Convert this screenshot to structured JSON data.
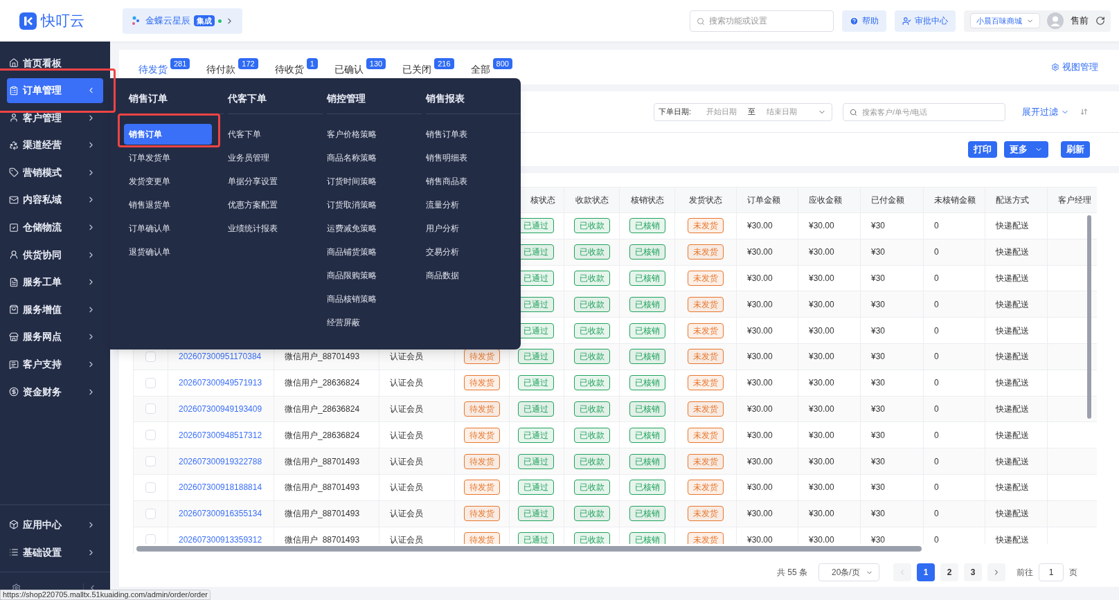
{
  "topbar": {
    "brand": "快叮云",
    "integration": {
      "name": "金蝶云星辰",
      "badge": "集成"
    },
    "search": {
      "placeholder": "搜索功能或设置"
    },
    "buttons": [
      {
        "label": "帮助",
        "kind": "help"
      },
      {
        "label": "审批中心",
        "kind": "approval"
      }
    ],
    "store": "小晨百味商城",
    "user": "售前"
  },
  "sidebar": {
    "items": [
      {
        "label": "首页看板",
        "kind": "page",
        "selected": false,
        "highlighted": false
      },
      {
        "label": "订单管理",
        "kind": "group",
        "selected": true,
        "expanded": true,
        "highlighted": true
      },
      {
        "label": "客户管理",
        "kind": "group",
        "selected": false,
        "expanded": false,
        "highlighted": false
      },
      {
        "label": "渠道经营",
        "kind": "group",
        "selected": false,
        "expanded": false,
        "highlighted": false
      },
      {
        "label": "营销模式",
        "kind": "group",
        "selected": false,
        "expanded": false,
        "highlighted": false
      },
      {
        "label": "内容私域",
        "kind": "group",
        "selected": false,
        "expanded": false,
        "highlighted": false
      },
      {
        "label": "仓储物流",
        "kind": "group",
        "selected": false,
        "expanded": false,
        "highlighted": false
      },
      {
        "label": "供货协同",
        "kind": "group",
        "selected": false,
        "expanded": false,
        "highlighted": false
      },
      {
        "label": "服务工单",
        "kind": "group",
        "selected": false,
        "expanded": false,
        "highlighted": false
      },
      {
        "label": "服务增值",
        "kind": "group",
        "selected": false,
        "expanded": false,
        "highlighted": false
      },
      {
        "label": "服务网点",
        "kind": "group",
        "selected": false,
        "expanded": false,
        "highlighted": false
      },
      {
        "label": "客户支持",
        "kind": "group",
        "selected": false,
        "expanded": false,
        "highlighted": false
      },
      {
        "label": "资金财务",
        "kind": "group",
        "selected": false,
        "expanded": false,
        "highlighted": false
      }
    ],
    "bottom_items": [
      {
        "label": "应用中心",
        "kind": "group",
        "selected": false,
        "expanded": false,
        "highlighted": false
      },
      {
        "label": "基础设置",
        "kind": "group",
        "selected": false,
        "expanded": false,
        "highlighted": false
      }
    ]
  },
  "tabs": [
    {
      "label": "待发货",
      "count": "281",
      "selected": true
    },
    {
      "label": "待付款",
      "count": "172",
      "selected": false
    },
    {
      "label": "待收货",
      "count": "1",
      "selected": false
    },
    {
      "label": "已确认",
      "count": "130",
      "selected": false
    },
    {
      "label": "已关闭",
      "count": "216",
      "selected": false
    },
    {
      "label": "全部",
      "count": "800",
      "selected": false
    }
  ],
  "view_manage": "视图管理",
  "filters": {
    "date_label": "下单日期:",
    "start_placeholder": "开始日期",
    "separator": "至",
    "end_placeholder": "结束日期",
    "search_placeholder": "搜索客户/单号/电话",
    "expand": "展开过滤"
  },
  "actions": [
    {
      "label": "打印",
      "kind": "button"
    },
    {
      "label": "更多",
      "kind": "dropdown"
    },
    {
      "label": "刷新",
      "kind": "button"
    }
  ],
  "table": {
    "columns": [
      "核状态",
      "收款状态",
      "核销状态",
      "发货状态",
      "订单金额",
      "应收金额",
      "已付金额",
      "未核销金额",
      "配送方式",
      "客户经理"
    ],
    "rows": [
      {
        "cells": [
          {
            "text": "已通过",
            "kind": "tag",
            "color": "#21a35d"
          },
          {
            "text": "已收款",
            "kind": "tag",
            "color": "#21a35d"
          },
          {
            "text": "已核销",
            "kind": "tag",
            "color": "#21a35d"
          },
          {
            "text": "未发货",
            "kind": "tag",
            "color": "#e8772e"
          },
          {
            "text": "¥30.00",
            "kind": "text"
          },
          {
            "text": "¥30.00",
            "kind": "text"
          },
          {
            "text": "¥30",
            "kind": "text"
          },
          {
            "text": "0",
            "kind": "text"
          },
          {
            "text": "快递配送",
            "kind": "text"
          }
        ]
      },
      {
        "cells": [
          {
            "text": "已通过",
            "kind": "tag",
            "color": "#21a35d"
          },
          {
            "text": "已收款",
            "kind": "tag",
            "color": "#21a35d"
          },
          {
            "text": "已核销",
            "kind": "tag",
            "color": "#21a35d"
          },
          {
            "text": "未发货",
            "kind": "tag",
            "color": "#e8772e"
          },
          {
            "text": "¥30.00",
            "kind": "text"
          },
          {
            "text": "¥30.00",
            "kind": "text"
          },
          {
            "text": "¥30",
            "kind": "text"
          },
          {
            "text": "0",
            "kind": "text"
          },
          {
            "text": "快递配送",
            "kind": "text"
          }
        ]
      },
      {
        "cells": [
          {
            "text": "已通过",
            "kind": "tag",
            "color": "#21a35d"
          },
          {
            "text": "已收款",
            "kind": "tag",
            "color": "#21a35d"
          },
          {
            "text": "已核销",
            "kind": "tag",
            "color": "#21a35d"
          },
          {
            "text": "未发货",
            "kind": "tag",
            "color": "#e8772e"
          },
          {
            "text": "¥30.00",
            "kind": "text"
          },
          {
            "text": "¥30.00",
            "kind": "text"
          },
          {
            "text": "¥30",
            "kind": "text"
          },
          {
            "text": "0",
            "kind": "text"
          },
          {
            "text": "快递配送",
            "kind": "text"
          }
        ]
      },
      {
        "cells": [
          {
            "text": "已通过",
            "kind": "tag",
            "color": "#21a35d"
          },
          {
            "text": "已收款",
            "kind": "tag",
            "color": "#21a35d"
          },
          {
            "text": "已核销",
            "kind": "tag",
            "color": "#21a35d"
          },
          {
            "text": "未发货",
            "kind": "tag",
            "color": "#e8772e"
          },
          {
            "text": "¥30.00",
            "kind": "text"
          },
          {
            "text": "¥30.00",
            "kind": "text"
          },
          {
            "text": "¥30",
            "kind": "text"
          },
          {
            "text": "0",
            "kind": "text"
          },
          {
            "text": "快递配送",
            "kind": "text"
          }
        ]
      },
      {
        "cells": [
          {
            "text": "已通过",
            "kind": "tag",
            "color": "#21a35d"
          },
          {
            "text": "已收款",
            "kind": "tag",
            "color": "#21a35d"
          },
          {
            "text": "已核销",
            "kind": "tag",
            "color": "#21a35d"
          },
          {
            "text": "未发货",
            "kind": "tag",
            "color": "#e8772e"
          },
          {
            "text": "¥30.00",
            "kind": "text"
          },
          {
            "text": "¥30.00",
            "kind": "text"
          },
          {
            "text": "¥30",
            "kind": "text"
          },
          {
            "text": "0",
            "kind": "text"
          },
          {
            "text": "快递配送",
            "kind": "text"
          }
        ]
      },
      {
        "checked": false,
        "cells": [
          {
            "text": "202607300951170384",
            "kind": "link"
          },
          {
            "text": "微信用户_88701493",
            "kind": "text"
          },
          {
            "text": "认证会员",
            "kind": "text"
          },
          {
            "text": "待发货",
            "kind": "tag",
            "color": "#e8772e"
          },
          {
            "text": "已通过",
            "kind": "tag",
            "color": "#21a35d"
          },
          {
            "text": "已收款",
            "kind": "tag",
            "color": "#21a35d"
          },
          {
            "text": "已核销",
            "kind": "tag",
            "color": "#21a35d"
          },
          {
            "text": "未发货",
            "kind": "tag",
            "color": "#e8772e"
          },
          {
            "text": "¥30.00",
            "kind": "text"
          },
          {
            "text": "¥30.00",
            "kind": "text"
          },
          {
            "text": "¥30",
            "kind": "text"
          },
          {
            "text": "0",
            "kind": "text"
          },
          {
            "text": "快递配送",
            "kind": "text"
          }
        ]
      },
      {
        "checked": false,
        "cells": [
          {
            "text": "202607300949571913",
            "kind": "link"
          },
          {
            "text": "微信用户_28636824",
            "kind": "text"
          },
          {
            "text": "认证会员",
            "kind": "text"
          },
          {
            "text": "待发货",
            "kind": "tag",
            "color": "#e8772e"
          },
          {
            "text": "已通过",
            "kind": "tag",
            "color": "#21a35d"
          },
          {
            "text": "已收款",
            "kind": "tag",
            "color": "#21a35d"
          },
          {
            "text": "已核销",
            "kind": "tag",
            "color": "#21a35d"
          },
          {
            "text": "未发货",
            "kind": "tag",
            "color": "#e8772e"
          },
          {
            "text": "¥30.00",
            "kind": "text"
          },
          {
            "text": "¥30.00",
            "kind": "text"
          },
          {
            "text": "¥30",
            "kind": "text"
          },
          {
            "text": "0",
            "kind": "text"
          },
          {
            "text": "快递配送",
            "kind": "text"
          }
        ]
      },
      {
        "checked": false,
        "cells": [
          {
            "text": "202607300949193409",
            "kind": "link"
          },
          {
            "text": "微信用户_28636824",
            "kind": "text"
          },
          {
            "text": "认证会员",
            "kind": "text"
          },
          {
            "text": "待发货",
            "kind": "tag",
            "color": "#e8772e"
          },
          {
            "text": "已通过",
            "kind": "tag",
            "color": "#21a35d"
          },
          {
            "text": "已收款",
            "kind": "tag",
            "color": "#21a35d"
          },
          {
            "text": "已核销",
            "kind": "tag",
            "color": "#21a35d"
          },
          {
            "text": "未发货",
            "kind": "tag",
            "color": "#e8772e"
          },
          {
            "text": "¥30.00",
            "kind": "text"
          },
          {
            "text": "¥30.00",
            "kind": "text"
          },
          {
            "text": "¥30",
            "kind": "text"
          },
          {
            "text": "0",
            "kind": "text"
          },
          {
            "text": "快递配送",
            "kind": "text"
          }
        ]
      },
      {
        "checked": false,
        "cells": [
          {
            "text": "202607300948517312",
            "kind": "link"
          },
          {
            "text": "微信用户_28636824",
            "kind": "text"
          },
          {
            "text": "认证会员",
            "kind": "text"
          },
          {
            "text": "待发货",
            "kind": "tag",
            "color": "#e8772e"
          },
          {
            "text": "已通过",
            "kind": "tag",
            "color": "#21a35d"
          },
          {
            "text": "已收款",
            "kind": "tag",
            "color": "#21a35d"
          },
          {
            "text": "已核销",
            "kind": "tag",
            "color": "#21a35d"
          },
          {
            "text": "未发货",
            "kind": "tag",
            "color": "#e8772e"
          },
          {
            "text": "¥30.00",
            "kind": "text"
          },
          {
            "text": "¥30.00",
            "kind": "text"
          },
          {
            "text": "¥30",
            "kind": "text"
          },
          {
            "text": "0",
            "kind": "text"
          },
          {
            "text": "快递配送",
            "kind": "text"
          }
        ]
      },
      {
        "checked": false,
        "cells": [
          {
            "text": "202607300919322788",
            "kind": "link"
          },
          {
            "text": "微信用户_88701493",
            "kind": "text"
          },
          {
            "text": "认证会员",
            "kind": "text"
          },
          {
            "text": "待发货",
            "kind": "tag",
            "color": "#e8772e"
          },
          {
            "text": "已通过",
            "kind": "tag",
            "color": "#21a35d"
          },
          {
            "text": "已收款",
            "kind": "tag",
            "color": "#21a35d"
          },
          {
            "text": "已核销",
            "kind": "tag",
            "color": "#21a35d"
          },
          {
            "text": "未发货",
            "kind": "tag",
            "color": "#e8772e"
          },
          {
            "text": "¥30.00",
            "kind": "text"
          },
          {
            "text": "¥30.00",
            "kind": "text"
          },
          {
            "text": "¥30",
            "kind": "text"
          },
          {
            "text": "0",
            "kind": "text"
          },
          {
            "text": "快递配送",
            "kind": "text"
          }
        ]
      },
      {
        "checked": false,
        "cells": [
          {
            "text": "202607300918188814",
            "kind": "link"
          },
          {
            "text": "微信用户_88701493",
            "kind": "text"
          },
          {
            "text": "认证会员",
            "kind": "text"
          },
          {
            "text": "待发货",
            "kind": "tag",
            "color": "#e8772e"
          },
          {
            "text": "已通过",
            "kind": "tag",
            "color": "#21a35d"
          },
          {
            "text": "已收款",
            "kind": "tag",
            "color": "#21a35d"
          },
          {
            "text": "已核销",
            "kind": "tag",
            "color": "#21a35d"
          },
          {
            "text": "未发货",
            "kind": "tag",
            "color": "#e8772e"
          },
          {
            "text": "¥30.00",
            "kind": "text"
          },
          {
            "text": "¥30.00",
            "kind": "text"
          },
          {
            "text": "¥30",
            "kind": "text"
          },
          {
            "text": "0",
            "kind": "text"
          },
          {
            "text": "快递配送",
            "kind": "text"
          }
        ]
      },
      {
        "checked": false,
        "cells": [
          {
            "text": "202607300916355134",
            "kind": "link"
          },
          {
            "text": "微信用户_88701493",
            "kind": "text"
          },
          {
            "text": "认证会员",
            "kind": "text"
          },
          {
            "text": "待发货",
            "kind": "tag",
            "color": "#e8772e"
          },
          {
            "text": "已通过",
            "kind": "tag",
            "color": "#21a35d"
          },
          {
            "text": "已收款",
            "kind": "tag",
            "color": "#21a35d"
          },
          {
            "text": "已核销",
            "kind": "tag",
            "color": "#21a35d"
          },
          {
            "text": "未发货",
            "kind": "tag",
            "color": "#e8772e"
          },
          {
            "text": "¥30.00",
            "kind": "text"
          },
          {
            "text": "¥30.00",
            "kind": "text"
          },
          {
            "text": "¥30",
            "kind": "text"
          },
          {
            "text": "0",
            "kind": "text"
          },
          {
            "text": "快递配送",
            "kind": "text"
          }
        ]
      },
      {
        "checked": false,
        "cells": [
          {
            "text": "202607300913359312",
            "kind": "link"
          },
          {
            "text": "微信用户_88701493",
            "kind": "text"
          },
          {
            "text": "认证会员",
            "kind": "text"
          },
          {
            "text": "待发货",
            "kind": "tag",
            "color": "#e8772e"
          },
          {
            "text": "已通过",
            "kind": "tag",
            "color": "#21a35d"
          },
          {
            "text": "已收款",
            "kind": "tag",
            "color": "#21a35d"
          },
          {
            "text": "已核销",
            "kind": "tag",
            "color": "#21a35d"
          },
          {
            "text": "未发货",
            "kind": "tag",
            "color": "#e8772e"
          },
          {
            "text": "¥30.00",
            "kind": "text"
          },
          {
            "text": "¥30.00",
            "kind": "text"
          },
          {
            "text": "¥30",
            "kind": "text"
          },
          {
            "text": "0",
            "kind": "text"
          },
          {
            "text": "快递配送",
            "kind": "text"
          }
        ]
      }
    ]
  },
  "pagination": {
    "total": "共 55 条",
    "page_size": "20条/页",
    "prev": {
      "disabled": true
    },
    "pages": [
      {
        "label": "1",
        "selected": true
      },
      {
        "label": "2",
        "selected": false
      },
      {
        "label": "3",
        "selected": false
      }
    ],
    "next": {
      "disabled": false
    },
    "goto_label": "前往",
    "goto_value": "1",
    "page_unit": "页"
  },
  "flyout": {
    "sections": [
      {
        "title": "销售订单",
        "items": [
          {
            "label": "销售订单",
            "selected": true,
            "highlighted": true
          },
          {
            "label": "订单发货单",
            "selected": false,
            "highlighted": false
          },
          {
            "label": "发货变更单",
            "selected": false,
            "highlighted": false
          },
          {
            "label": "销售退货单",
            "selected": false,
            "highlighted": false
          },
          {
            "label": "订单确认单",
            "selected": false,
            "highlighted": false
          },
          {
            "label": "退货确认单",
            "selected": false,
            "highlighted": false
          }
        ]
      },
      {
        "title": "代客下单",
        "items": [
          {
            "label": "代客下单",
            "selected": false,
            "highlighted": false
          },
          {
            "label": "业务员管理",
            "selected": false,
            "highlighted": false
          },
          {
            "label": "单据分享设置",
            "selected": false,
            "highlighted": false
          },
          {
            "label": "优惠方案配置",
            "selected": false,
            "highlighted": false
          },
          {
            "label": "业绩统计报表",
            "selected": false,
            "highlighted": false
          }
        ]
      },
      {
        "title": "销控管理",
        "items": [
          {
            "label": "客户价格策略",
            "selected": false,
            "highlighted": false
          },
          {
            "label": "商品名称策略",
            "selected": false,
            "highlighted": false
          },
          {
            "label": "订货时间策略",
            "selected": false,
            "highlighted": false
          },
          {
            "label": "订货取消策略",
            "selected": false,
            "highlighted": false
          },
          {
            "label": "运费减免策略",
            "selected": false,
            "highlighted": false
          },
          {
            "label": "商品铺货策略",
            "selected": false,
            "highlighted": false
          },
          {
            "label": "商品限购策略",
            "selected": false,
            "highlighted": false
          },
          {
            "label": "商品核销策略",
            "selected": false,
            "highlighted": false
          },
          {
            "label": "经营屏蔽",
            "selected": false,
            "highlighted": false
          }
        ]
      },
      {
        "title": "销售报表",
        "items": [
          {
            "label": "销售订单表",
            "selected": false,
            "highlighted": false
          },
          {
            "label": "销售明细表",
            "selected": false,
            "highlighted": false
          },
          {
            "label": "销售商品表",
            "selected": false,
            "highlighted": false
          },
          {
            "label": "流量分析",
            "selected": false,
            "highlighted": false
          },
          {
            "label": "用户分析",
            "selected": false,
            "highlighted": false
          },
          {
            "label": "交易分析",
            "selected": false,
            "highlighted": false
          },
          {
            "label": "商品数据",
            "selected": false,
            "highlighted": false
          }
        ]
      }
    ]
  },
  "status_url": "https://shop220705.malltx.51kuaiding.com/admin/order/order"
}
